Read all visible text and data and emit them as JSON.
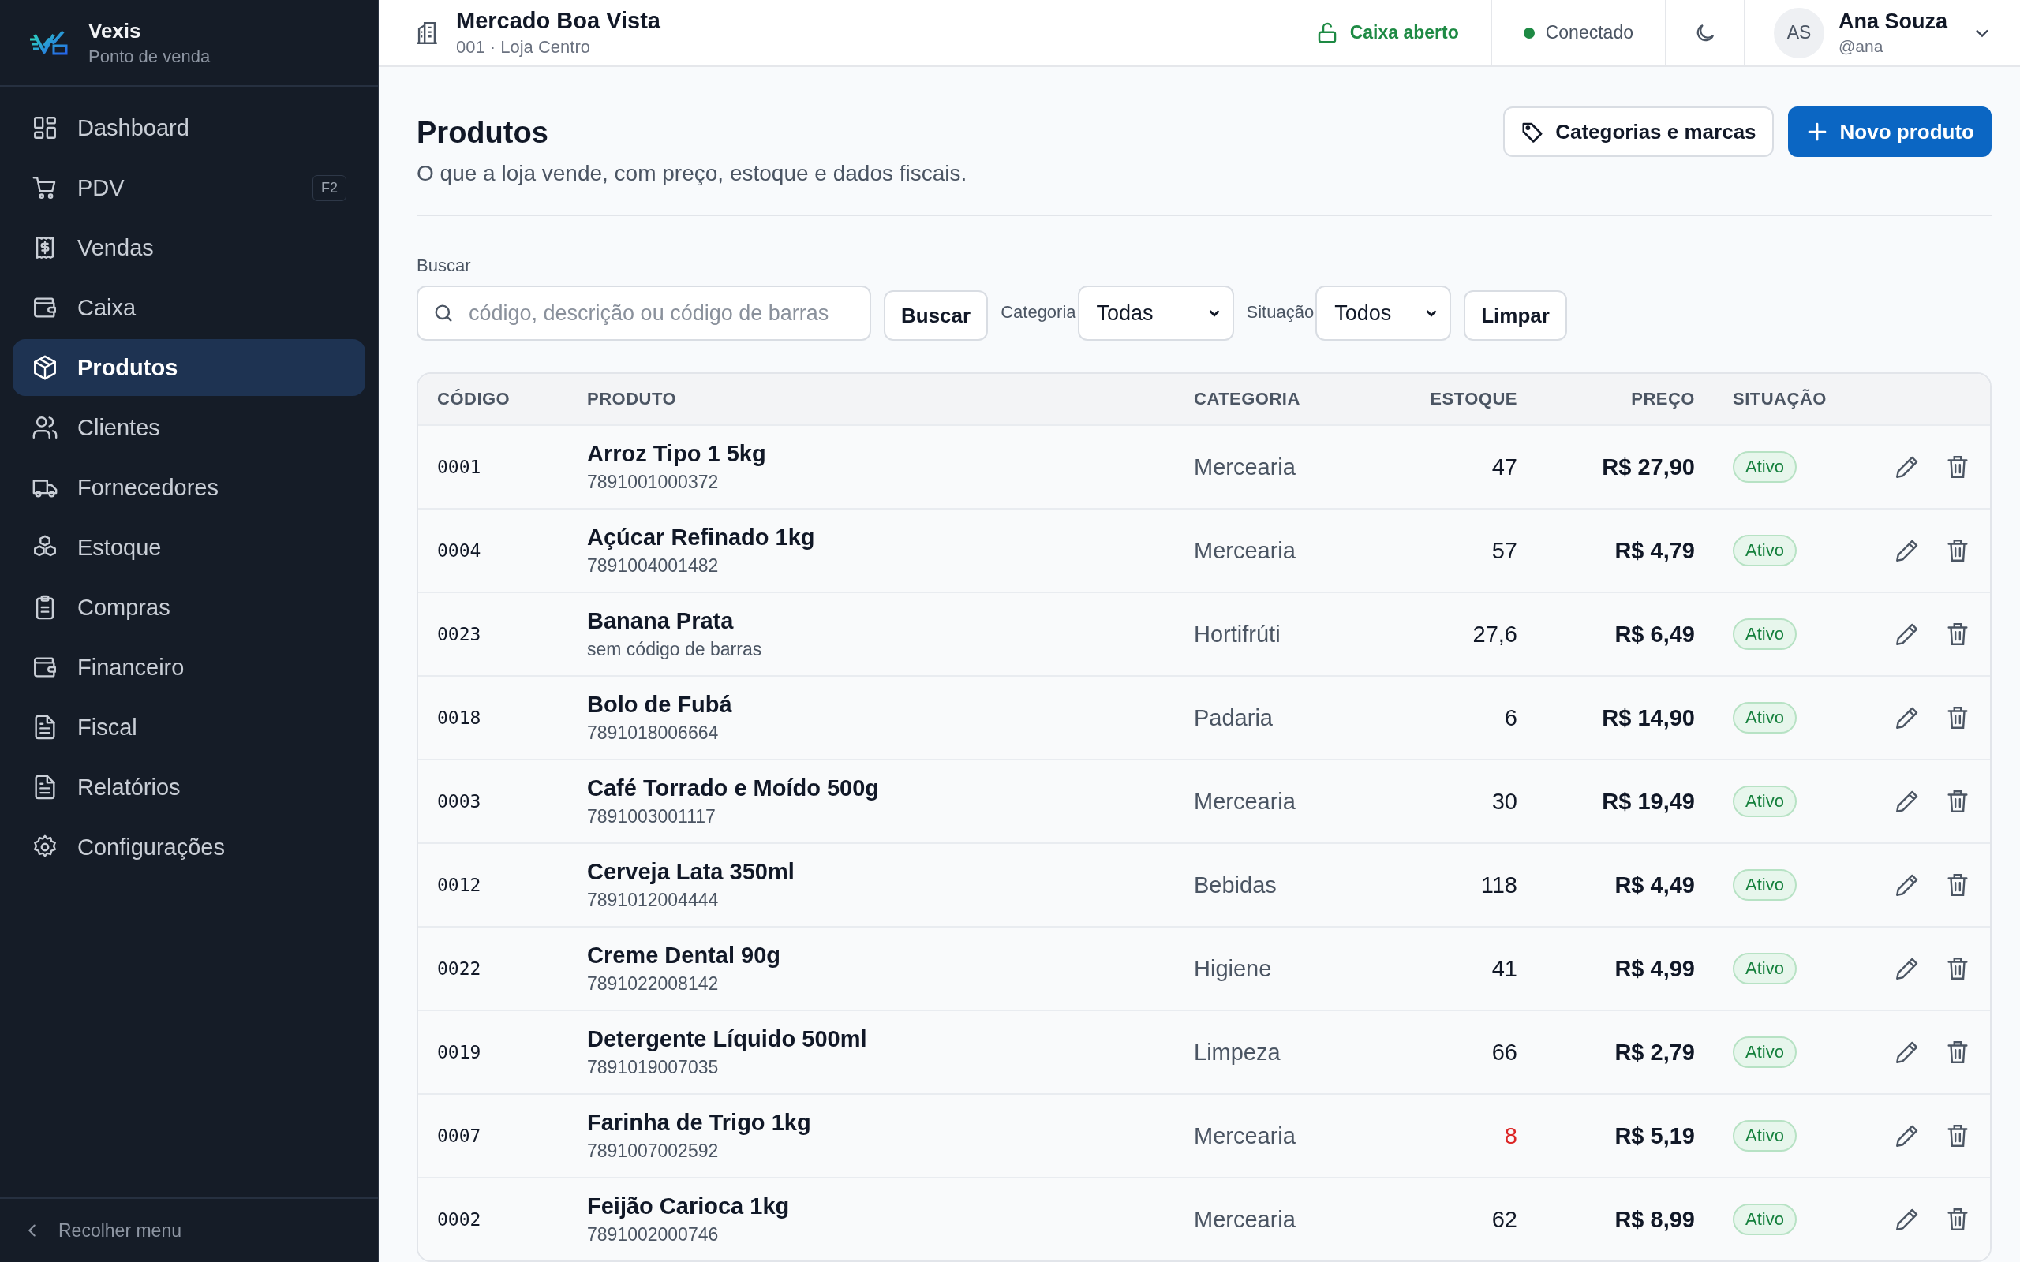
{
  "brand": {
    "name": "Vexis",
    "subtitle": "Ponto de venda"
  },
  "nav": [
    {
      "label": "Dashboard",
      "selected": false
    },
    {
      "label": "PDV",
      "selected": false,
      "shortcut": "F2"
    },
    {
      "label": "Vendas",
      "selected": false
    },
    {
      "label": "Caixa",
      "selected": false
    },
    {
      "label": "Produtos",
      "selected": true
    },
    {
      "label": "Clientes",
      "selected": false
    },
    {
      "label": "Fornecedores",
      "selected": false
    },
    {
      "label": "Estoque",
      "selected": false
    },
    {
      "label": "Compras",
      "selected": false
    },
    {
      "label": "Financeiro",
      "selected": false
    },
    {
      "label": "Fiscal",
      "selected": false
    },
    {
      "label": "Relatórios",
      "selected": false
    },
    {
      "label": "Configurações",
      "selected": false
    }
  ],
  "collapse_label": "Recolher menu",
  "header": {
    "store": "Mercado Boa Vista",
    "store_sub": "001 · Loja Centro",
    "register": "Caixa aberto",
    "connection": "Conectado",
    "user": {
      "initials": "AS",
      "name": "Ana Souza",
      "handle": "@ana"
    }
  },
  "page": {
    "title": "Produtos",
    "subtitle": "O que a loja vende, com preço, estoque e dados fiscais.",
    "secondary_button": "Categorias e marcas",
    "primary_button": "Novo produto"
  },
  "filters": {
    "search_label": "Buscar",
    "search_placeholder": "código, descrição ou código de barras",
    "search_button": "Buscar",
    "category_label": "Categoria",
    "category_value": "Todas",
    "status_label": "Situação",
    "status_value": "Todos",
    "clear_button": "Limpar"
  },
  "table": {
    "columns": [
      "CÓDIGO",
      "PRODUTO",
      "CATEGORIA",
      "ESTOQUE",
      "PREÇO",
      "SITUAÇÃO"
    ],
    "rows": [
      {
        "code": "0001",
        "name": "Arroz Tipo 1 5kg",
        "barcode": "7891001000372",
        "category": "Mercearia",
        "stock": "47",
        "low_stock": false,
        "price": "R$ 27,90",
        "status": "Ativo"
      },
      {
        "code": "0004",
        "name": "Açúcar Refinado 1kg",
        "barcode": "7891004001482",
        "category": "Mercearia",
        "stock": "57",
        "low_stock": false,
        "price": "R$ 4,79",
        "status": "Ativo"
      },
      {
        "code": "0023",
        "name": "Banana Prata",
        "barcode": "sem código de barras",
        "category": "Hortifrúti",
        "stock": "27,6",
        "low_stock": false,
        "price": "R$ 6,49",
        "status": "Ativo"
      },
      {
        "code": "0018",
        "name": "Bolo de Fubá",
        "barcode": "7891018006664",
        "category": "Padaria",
        "stock": "6",
        "low_stock": false,
        "price": "R$ 14,90",
        "status": "Ativo"
      },
      {
        "code": "0003",
        "name": "Café Torrado e Moído 500g",
        "barcode": "7891003001117",
        "category": "Mercearia",
        "stock": "30",
        "low_stock": false,
        "price": "R$ 19,49",
        "status": "Ativo"
      },
      {
        "code": "0012",
        "name": "Cerveja Lata 350ml",
        "barcode": "7891012004444",
        "category": "Bebidas",
        "stock": "118",
        "low_stock": false,
        "price": "R$ 4,49",
        "status": "Ativo"
      },
      {
        "code": "0022",
        "name": "Creme Dental 90g",
        "barcode": "7891022008142",
        "category": "Higiene",
        "stock": "41",
        "low_stock": false,
        "price": "R$ 4,99",
        "status": "Ativo"
      },
      {
        "code": "0019",
        "name": "Detergente Líquido 500ml",
        "barcode": "7891019007035",
        "category": "Limpeza",
        "stock": "66",
        "low_stock": false,
        "price": "R$ 2,79",
        "status": "Ativo"
      },
      {
        "code": "0007",
        "name": "Farinha de Trigo 1kg",
        "barcode": "7891007002592",
        "category": "Mercearia",
        "stock": "8",
        "low_stock": true,
        "price": "R$ 5,19",
        "status": "Ativo"
      },
      {
        "code": "0002",
        "name": "Feijão Carioca 1kg",
        "barcode": "7891002000746",
        "category": "Mercearia",
        "stock": "62",
        "low_stock": false,
        "price": "R$ 8,99",
        "status": "Ativo"
      }
    ]
  }
}
